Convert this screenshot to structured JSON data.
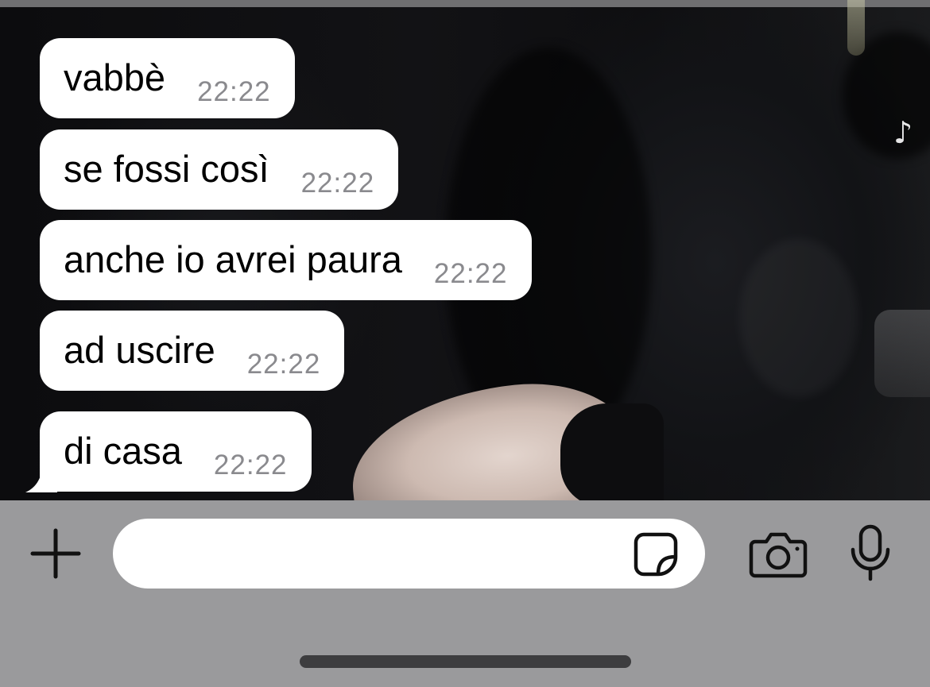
{
  "wallpaper": {
    "watermark_icon": "tiktok-icon"
  },
  "messages": [
    {
      "text": "vabbè",
      "time": "22:22"
    },
    {
      "text": "se fossi così",
      "time": "22:22"
    },
    {
      "text": "anche io avrei paura",
      "time": "22:22"
    },
    {
      "text": "ad uscire",
      "time": "22:22"
    },
    {
      "text": "di casa",
      "time": "22:22"
    }
  ],
  "input_bar": {
    "field_value": "",
    "field_placeholder": "",
    "icons": [
      "plus-icon",
      "sticker-icon",
      "camera-icon",
      "microphone-icon"
    ]
  },
  "colors": {
    "bubble": "#ffffff",
    "timestamp": "#8a8a8e",
    "input_bar_bg": "#9a9a9c",
    "icon": "#111111"
  }
}
